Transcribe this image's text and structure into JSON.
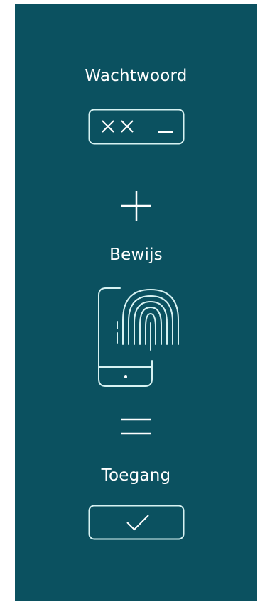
{
  "steps": {
    "password_label": "Wachtwoord",
    "proof_label": "Bewijs",
    "access_label": "Toegang"
  },
  "icons": {
    "password": "password-field-icon",
    "plus": "plus-icon",
    "proof": "phone-fingerprint-icon",
    "equals": "equals-icon",
    "access": "checkmark-box-icon"
  },
  "colors": {
    "panel_background": "#0b5160",
    "foreground": "#ffffff",
    "icon_stroke": "#d7f2f2"
  }
}
